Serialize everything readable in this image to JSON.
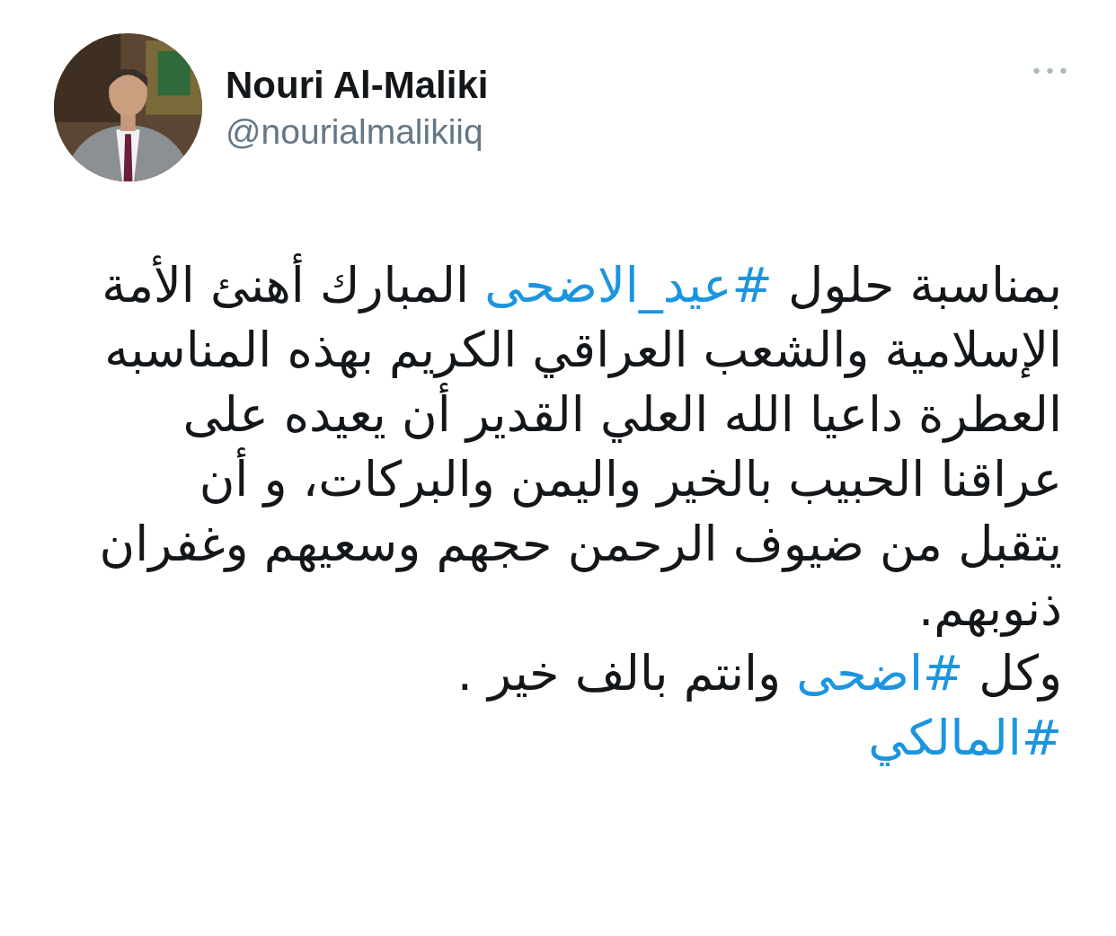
{
  "author": {
    "name": "Nouri Al-Maliki",
    "handle": "@nourialmalikiiq"
  },
  "more_button": {
    "label": "•••"
  },
  "paragraphs": [
    [
      {
        "kind": "text",
        "text": "بمناسبة حلول "
      },
      {
        "kind": "hashtag",
        "text": "#عيد_الاضحى"
      },
      {
        "kind": "text",
        "text": " المبارك أهنئ الأمة الإسلامية والشعب العراقي الكريم بهذه المناسبه العطرة  داعيا الله العلي القدير أن يعيده على عراقنا الحبيب بالخير واليمن والبركات، و أن يتقبل من ضيوف الرحمن حجهم وسعيهم وغفران ذنوبهم."
      }
    ],
    [
      {
        "kind": "text",
        "text": "وكل "
      },
      {
        "kind": "hashtag",
        "text": "#اضحى"
      },
      {
        "kind": "text",
        "text": " وانتم بالف خير ."
      }
    ],
    [
      {
        "kind": "hashtag",
        "text": "#المالكي"
      }
    ]
  ]
}
